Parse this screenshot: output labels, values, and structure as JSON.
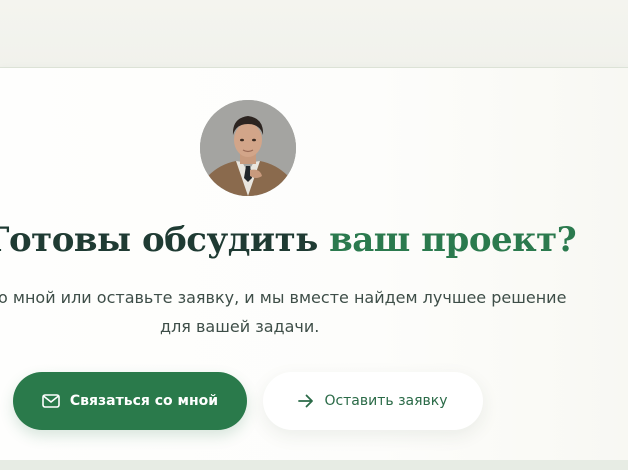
{
  "header": {
    "title_start": "Готовы обсудить ",
    "title_accent": "ваш проект?"
  },
  "description": {
    "line1": "о мной или оставьте заявку, и мы вместе найдем лучшее решение",
    "line2": "для вашей задачи."
  },
  "buttons": {
    "contact_label": "Связаться со мной",
    "contact_icon": "mail-icon",
    "request_label": "Оставить заявку",
    "request_icon": "arrow-right-icon"
  },
  "colors": {
    "accent": "#2b7a4e",
    "primary_button": "#2a7a4b",
    "heading": "#1f3b33",
    "text": "#3e4e48",
    "background": "#fdfdfb"
  }
}
